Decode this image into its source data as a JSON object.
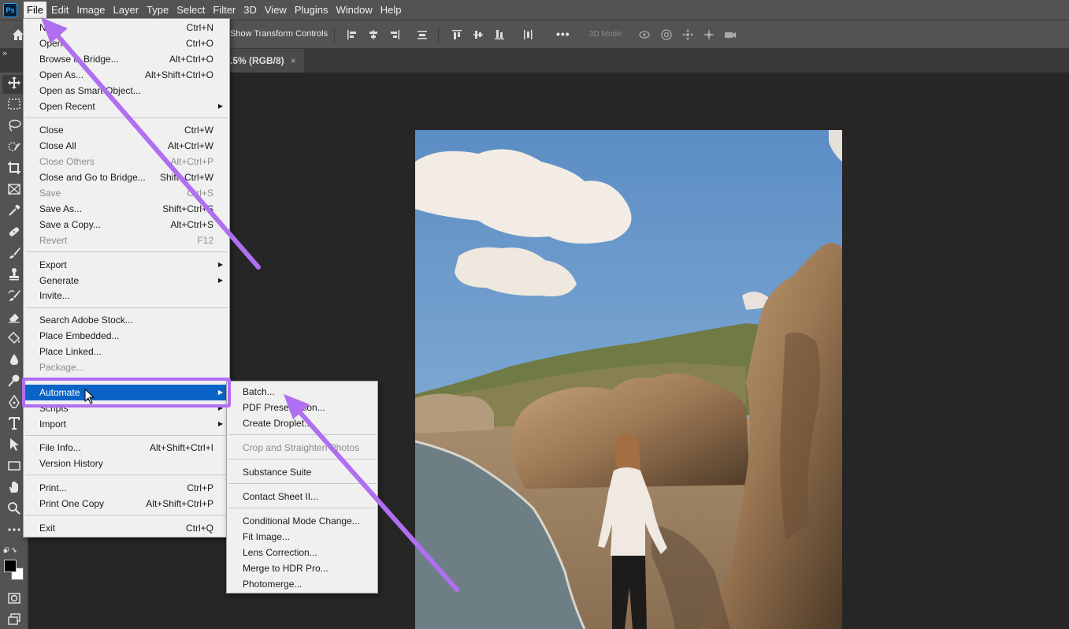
{
  "menubar": {
    "logo": "Ps",
    "items": [
      "File",
      "Edit",
      "Image",
      "Layer",
      "Type",
      "Select",
      "Filter",
      "3D",
      "View",
      "Plugins",
      "Window",
      "Help"
    ],
    "active": "File"
  },
  "optionsbar": {
    "transform_label": "Show Transform Controls",
    "mode_3d_label": "3D Mode:",
    "more_label": "•••"
  },
  "tabrow": {
    "collapse_glyph": "»",
    "doc_title": ".5% (RGB/8)",
    "close_glyph": "×"
  },
  "file_menu": {
    "items": [
      {
        "label": "New...",
        "shortcut": "Ctrl+N"
      },
      {
        "label": "Open...",
        "shortcut": "Ctrl+O"
      },
      {
        "label": "Browse in Bridge...",
        "shortcut": "Alt+Ctrl+O"
      },
      {
        "label": "Open As...",
        "shortcut": "Alt+Shift+Ctrl+O"
      },
      {
        "label": "Open as Smart Object...",
        "shortcut": ""
      },
      {
        "label": "Open Recent",
        "shortcut": ""
      },
      {
        "label": "Close",
        "shortcut": "Ctrl+W"
      },
      {
        "label": "Close All",
        "shortcut": "Alt+Ctrl+W"
      },
      {
        "label": "Close Others",
        "shortcut": "Alt+Ctrl+P"
      },
      {
        "label": "Close and Go to Bridge...",
        "shortcut": "Shift+Ctrl+W"
      },
      {
        "label": "Save",
        "shortcut": "Ctrl+S"
      },
      {
        "label": "Save As...",
        "shortcut": "Shift+Ctrl+S"
      },
      {
        "label": "Save a Copy...",
        "shortcut": "Alt+Ctrl+S"
      },
      {
        "label": "Revert",
        "shortcut": "F12"
      },
      {
        "label": "Export",
        "shortcut": ""
      },
      {
        "label": "Generate",
        "shortcut": ""
      },
      {
        "label": "Invite...",
        "shortcut": ""
      },
      {
        "label": "Search Adobe Stock...",
        "shortcut": ""
      },
      {
        "label": "Place Embedded...",
        "shortcut": ""
      },
      {
        "label": "Place Linked...",
        "shortcut": ""
      },
      {
        "label": "Package...",
        "shortcut": ""
      },
      {
        "label": "Automate",
        "shortcut": ""
      },
      {
        "label": "Scripts",
        "shortcut": ""
      },
      {
        "label": "Import",
        "shortcut": ""
      },
      {
        "label": "File Info...",
        "shortcut": "Alt+Shift+Ctrl+I"
      },
      {
        "label": "Version History",
        "shortcut": ""
      },
      {
        "label": "Print...",
        "shortcut": "Ctrl+P"
      },
      {
        "label": "Print One Copy",
        "shortcut": "Alt+Shift+Ctrl+P"
      },
      {
        "label": "Exit",
        "shortcut": "Ctrl+Q"
      }
    ]
  },
  "automate_menu": {
    "items": [
      {
        "label": "Batch..."
      },
      {
        "label": "PDF Presentation..."
      },
      {
        "label": "Create Droplet..."
      },
      {
        "label": "Crop and Straighten Photos"
      },
      {
        "label": "Substance Suite"
      },
      {
        "label": "Contact Sheet II..."
      },
      {
        "label": "Conditional Mode Change..."
      },
      {
        "label": "Fit Image..."
      },
      {
        "label": "Lens Correction..."
      },
      {
        "label": "Merge to HDR Pro..."
      },
      {
        "label": "Photomerge..."
      }
    ]
  },
  "colors": {
    "menu_highlight": "#0a64c8",
    "annotation": "#b06ef0",
    "ui_panel": "#535353",
    "canvas_bg": "#262626"
  }
}
